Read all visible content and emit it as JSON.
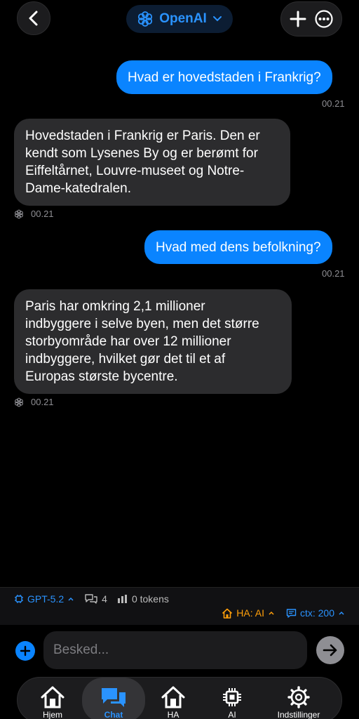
{
  "header": {
    "title": "OpenAI",
    "back_icon": "chevron-left-icon",
    "add_icon": "plus-icon",
    "more_icon": "ellipsis-icon"
  },
  "messages": [
    {
      "role": "user",
      "text": "Hvad er hovedstaden i Frankrig?",
      "time": "00.21"
    },
    {
      "role": "assistant",
      "lines": [
        "Hovedstaden i Frankrig er Paris. Den er",
        "kendt som Lysenes By og er berømt for",
        "Eiffeltårnet, Louvre-museet og Notre-",
        "Dame-katedralen."
      ],
      "time": "00.21"
    },
    {
      "role": "user",
      "text": "Hvad med dens befolkning?",
      "time": "00.21"
    },
    {
      "role": "assistant",
      "lines": [
        "Paris har omkring 2,1 millioner",
        "indbyggere i selve byen, men det større",
        "storbyområde har over 12 millioner",
        "indbyggere, hvilket gør det til et af",
        "Europas største bycentre."
      ],
      "time": "00.21"
    }
  ],
  "status": {
    "model": "GPT-5.2",
    "message_count": "4",
    "tokens": "0 tokens",
    "ha": "HA: AI",
    "ctx": "ctx: 200"
  },
  "composer": {
    "placeholder": "Besked..."
  },
  "tabs": [
    {
      "label": "Hjem",
      "icon": "home-icon"
    },
    {
      "label": "Chat",
      "icon": "chat-bubbles-icon",
      "active": true
    },
    {
      "label": "HA",
      "icon": "home-icon"
    },
    {
      "label": "AI",
      "icon": "chip-icon"
    },
    {
      "label": "Indstillinger",
      "icon": "gear-icon"
    }
  ],
  "colors": {
    "accent": "#0a84ff",
    "ha_orange": "#ff9f0a",
    "bubble_assistant": "#2c2c2e",
    "background": "#000000"
  }
}
